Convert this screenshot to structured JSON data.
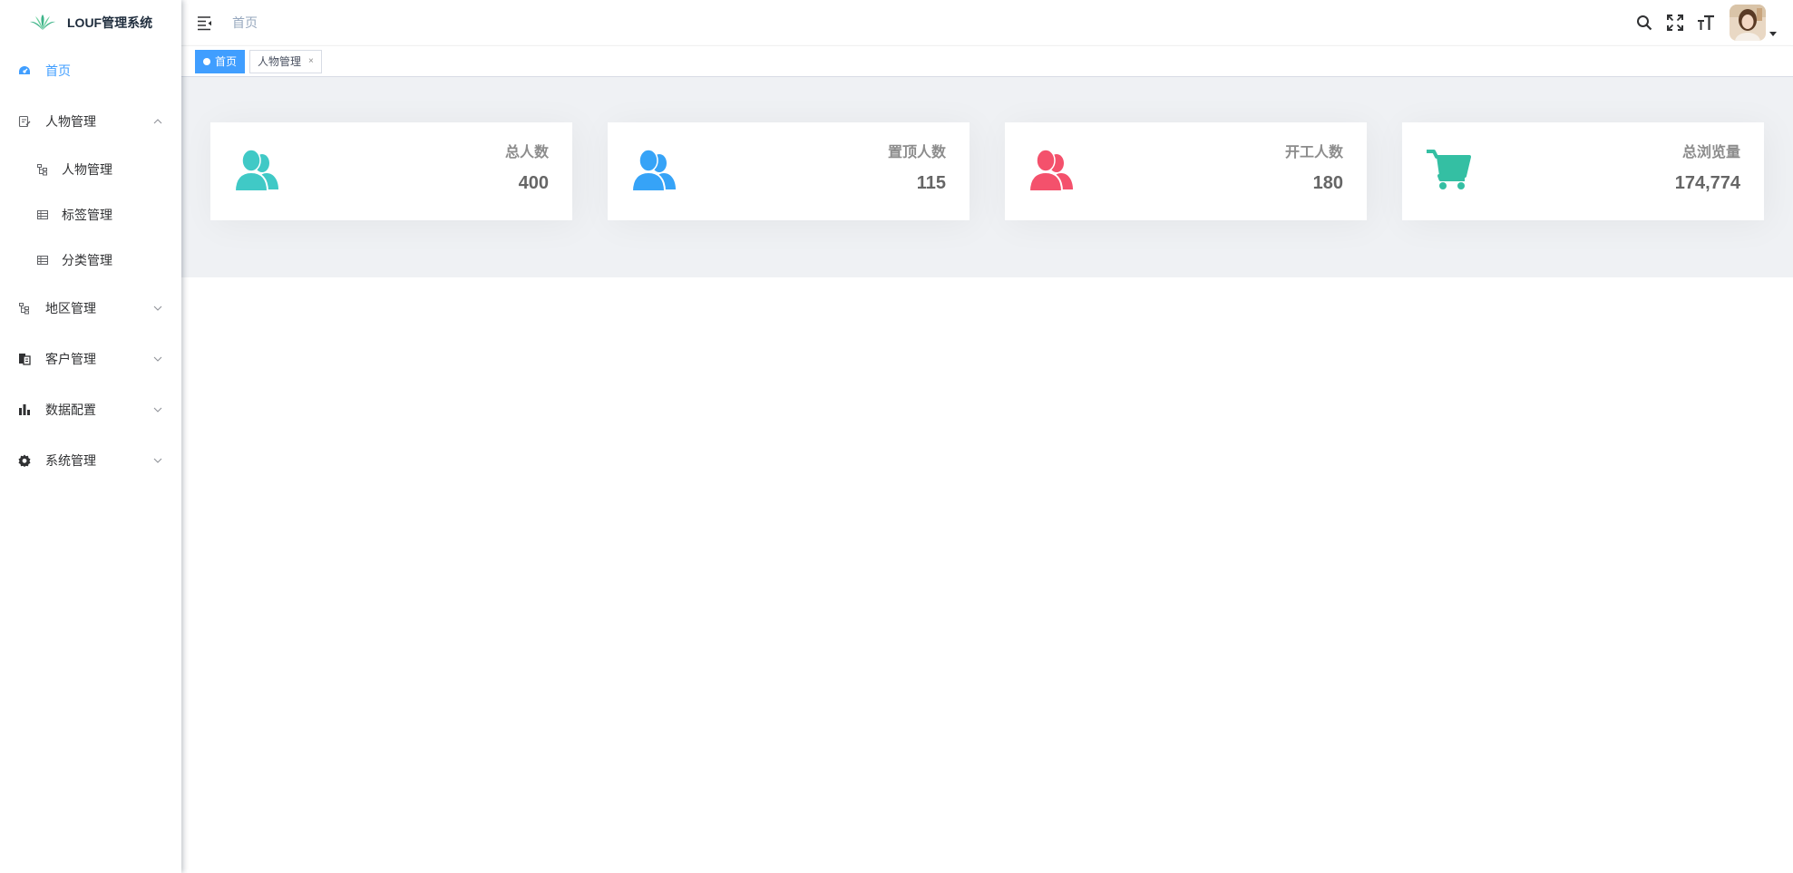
{
  "app": {
    "title": "LOUF管理系统"
  },
  "sidebar": {
    "items": [
      {
        "label": "首页",
        "icon": "dashboard-icon",
        "active": true
      },
      {
        "label": "人物管理",
        "icon": "form-icon",
        "expanded": true,
        "children": [
          {
            "label": "人物管理",
            "icon": "tree-icon"
          },
          {
            "label": "标签管理",
            "icon": "table-icon"
          },
          {
            "label": "分类管理",
            "icon": "table-icon"
          }
        ]
      },
      {
        "label": "地区管理",
        "icon": "tree-icon"
      },
      {
        "label": "客户管理",
        "icon": "clipboard-icon"
      },
      {
        "label": "数据配置",
        "icon": "chart-icon"
      },
      {
        "label": "系统管理",
        "icon": "gear-icon"
      }
    ]
  },
  "navbar": {
    "breadcrumb": "首页",
    "icons": [
      "search-icon",
      "fullscreen-icon",
      "font-size-icon"
    ]
  },
  "tags": [
    {
      "label": "首页",
      "active": true
    },
    {
      "label": "人物管理",
      "active": false,
      "close": "×"
    }
  ],
  "stats": [
    {
      "label": "总人数",
      "value": "400",
      "color": "#40c9c6",
      "icon": "peoples-icon"
    },
    {
      "label": "置顶人数",
      "value": "115",
      "color": "#36a3f7",
      "icon": "peoples-icon"
    },
    {
      "label": "开工人数",
      "value": "180",
      "color": "#f4516c",
      "icon": "peoples-icon"
    },
    {
      "label": "总浏览量",
      "value": "174,774",
      "color": "#34bfa3",
      "icon": "shopping-cart-icon"
    }
  ],
  "colors": {
    "accent": "#409eff",
    "content_bg": "#eff1f4"
  }
}
